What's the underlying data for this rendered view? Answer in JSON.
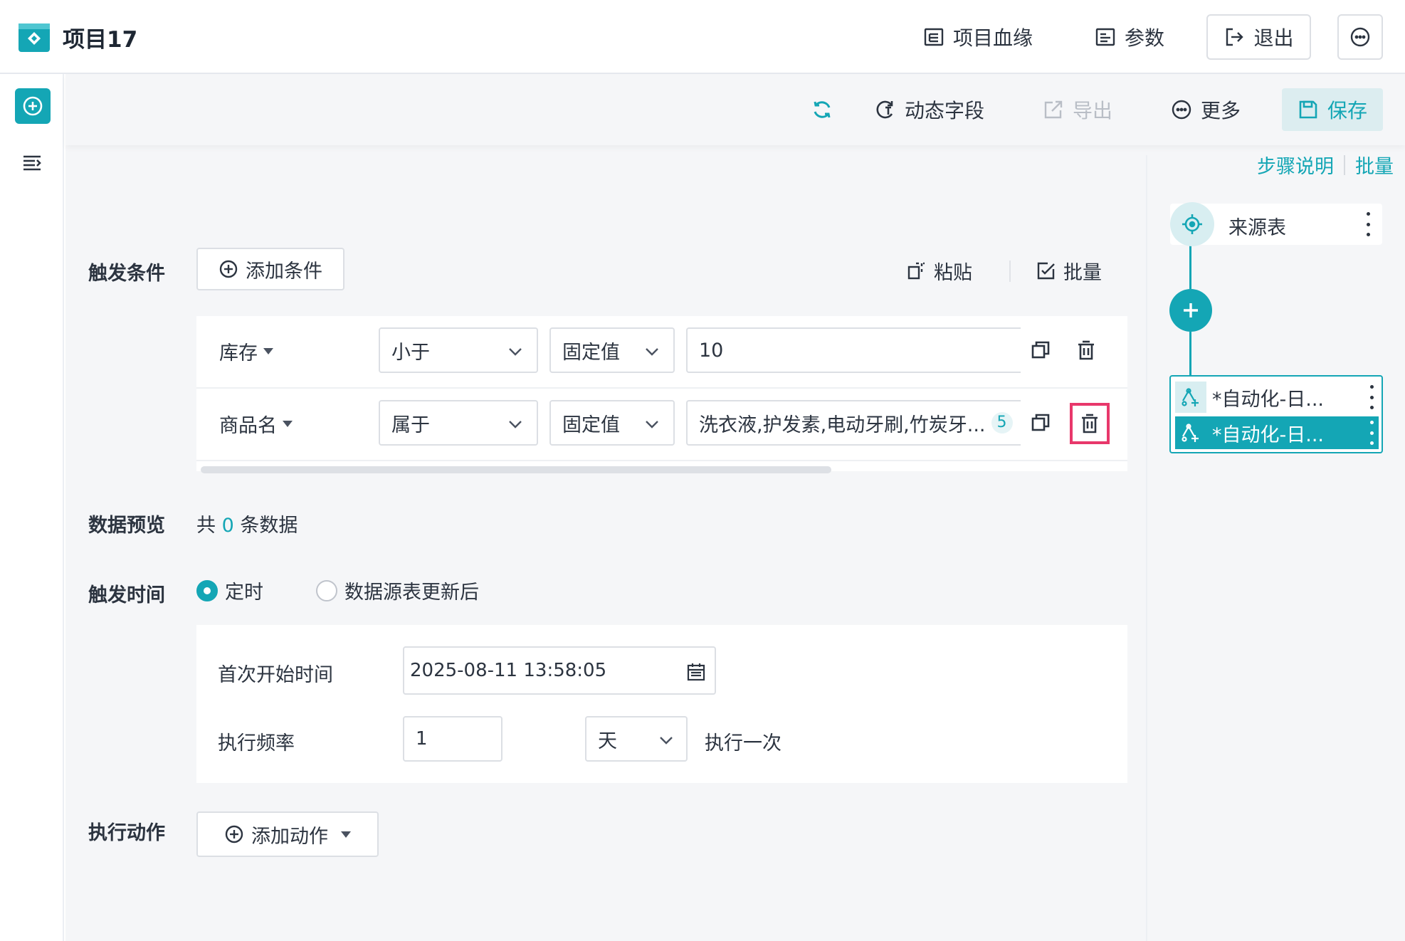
{
  "header": {
    "title": "项目17",
    "lineage_label": "项目血缘",
    "params_label": "参数",
    "exit_label": "退出"
  },
  "toolbar": {
    "dynamic_label": "动态字段",
    "export_label": "导出",
    "more_label": "更多",
    "save_label": "保存"
  },
  "trigger": {
    "section_label": "触发条件",
    "add_condition_label": "添加条件",
    "paste_label": "粘贴",
    "batch_label": "批量",
    "conditions": [
      {
        "field": "库存",
        "operator": "小于",
        "value_type": "固定值",
        "value": "10",
        "count": ""
      },
      {
        "field": "商品名",
        "operator": "属于",
        "value_type": "固定值",
        "value": "洗衣液,护发素,电动牙刷,竹炭牙...",
        "count": "5"
      }
    ]
  },
  "preview": {
    "section_label": "数据预览",
    "prefix": "共",
    "count": "0",
    "suffix": "条数据"
  },
  "trigger_time": {
    "section_label": "触发时间",
    "option_scheduled": "定时",
    "option_after_update": "数据源表更新后",
    "selected": "定时",
    "first_start_label": "首次开始时间",
    "first_start_value": "2025-08-11 13:58:05",
    "frequency_label": "执行频率",
    "frequency_value": "1",
    "frequency_unit": "天",
    "frequency_suffix": "执行一次"
  },
  "action": {
    "section_label": "执行动作",
    "add_action_label": "添加动作"
  },
  "side": {
    "step_desc_label": "步骤说明",
    "batch_label": "批量",
    "source_node_label": "来源表",
    "automation_items": [
      "*自动化-日...",
      "*自动化-日..."
    ]
  },
  "colors": {
    "accent": "#14a6b5",
    "highlight": "#e8386b",
    "background": "#f5f6f8"
  }
}
